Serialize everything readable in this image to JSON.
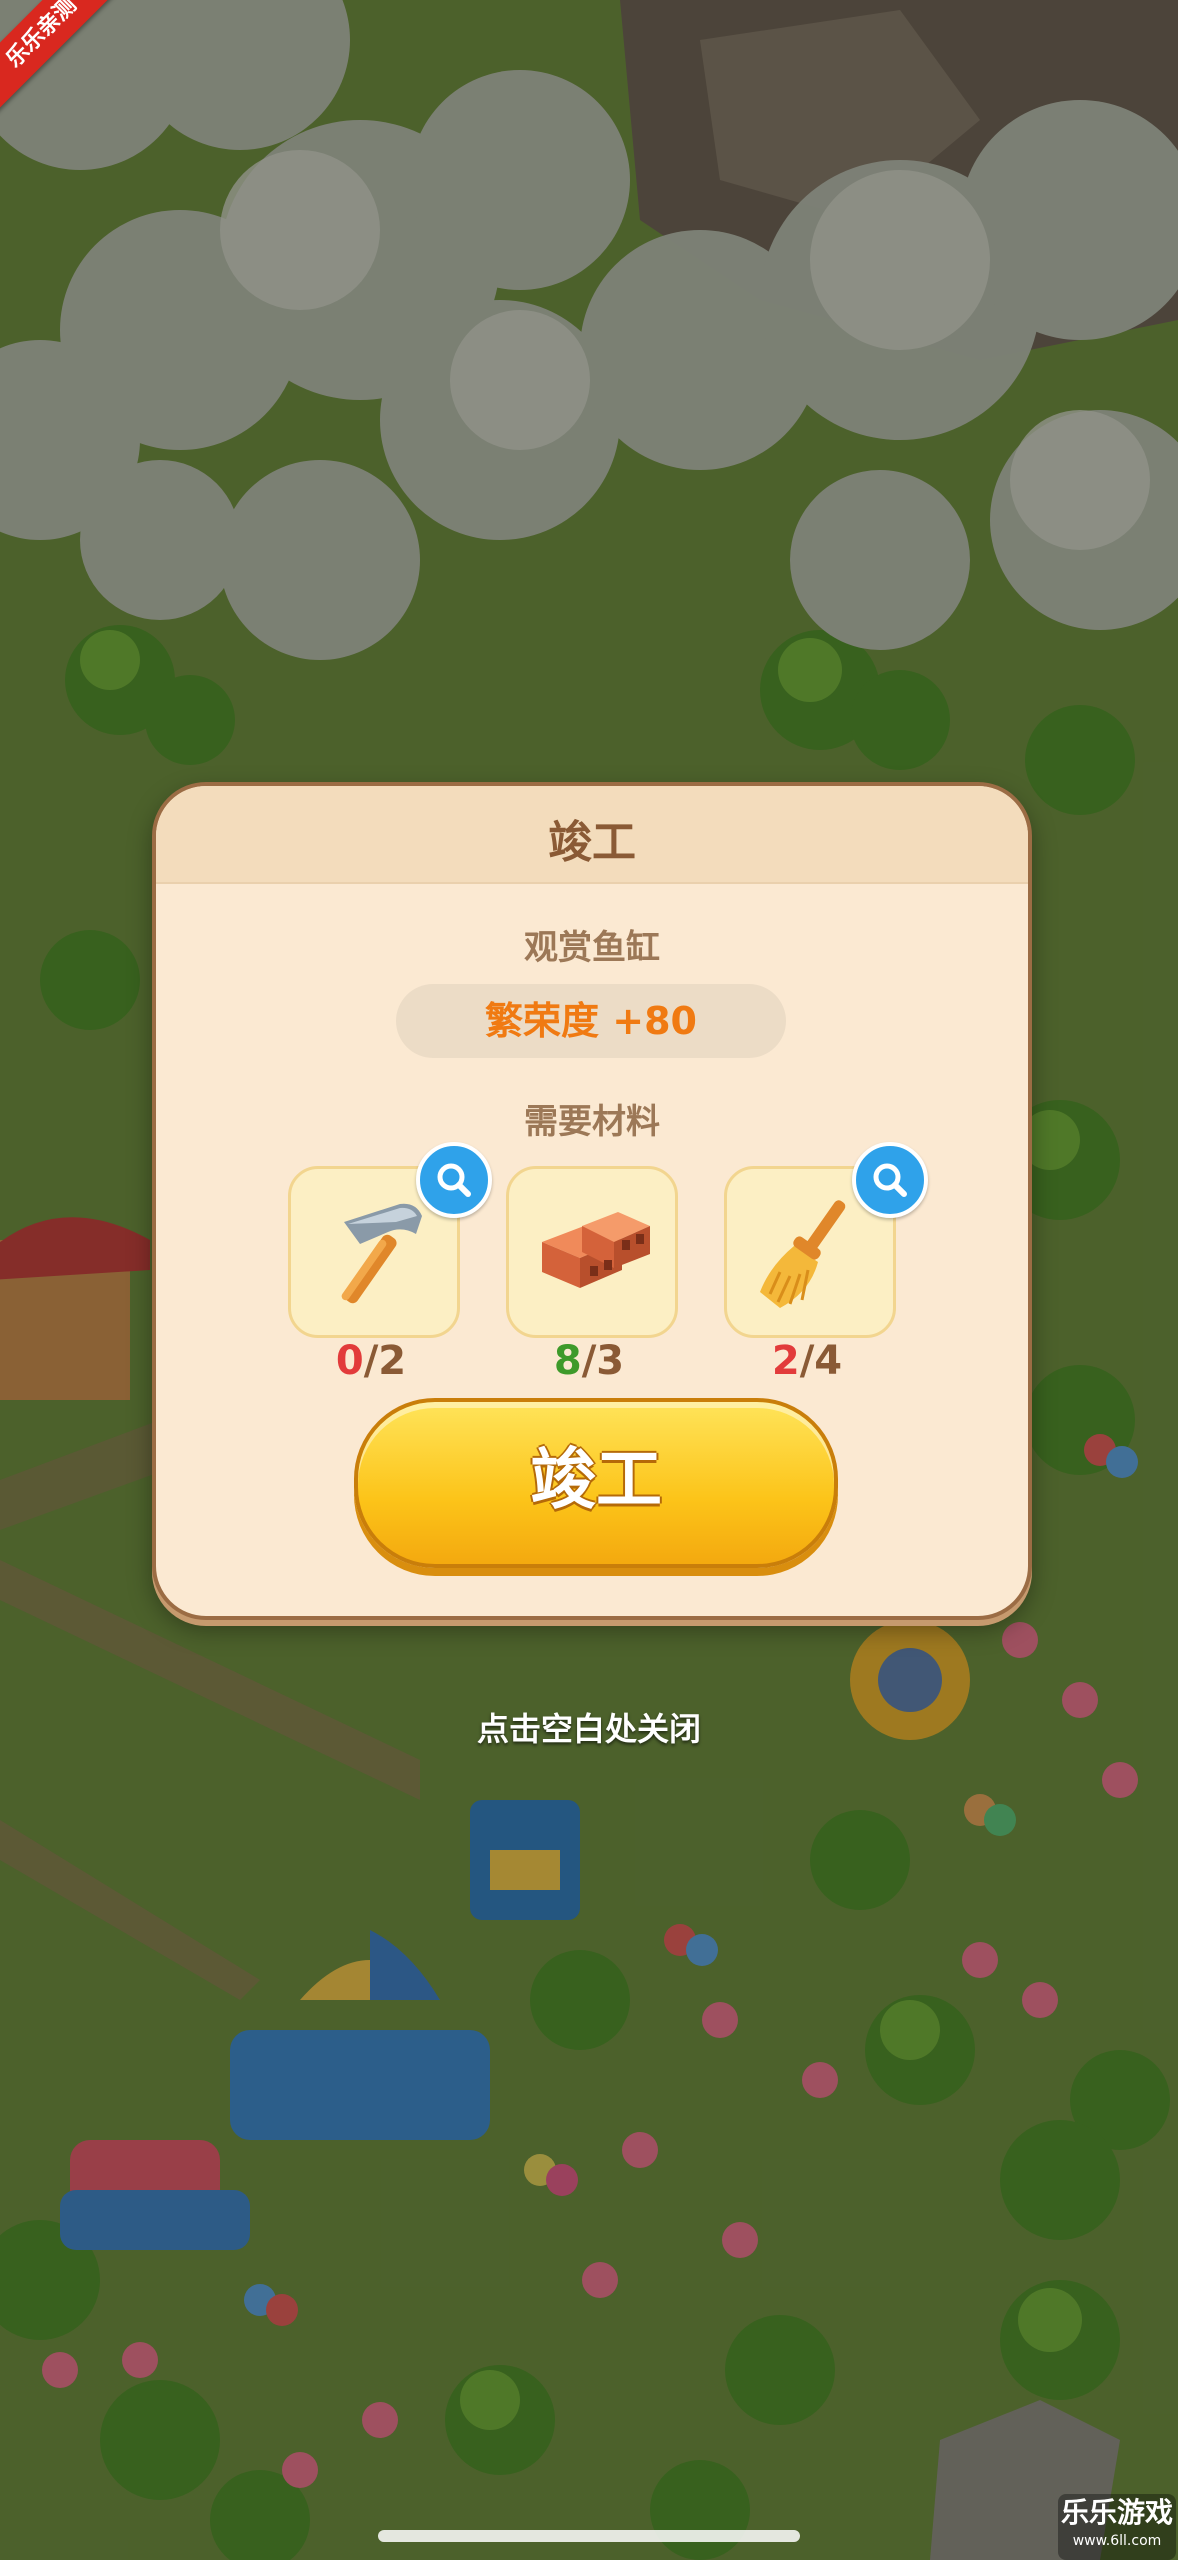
{
  "corner_tag": "乐乐亲测",
  "dialog": {
    "title": "竣工",
    "building_name": "观赏鱼缸",
    "prosperity": "繁荣度 +80",
    "materials_label": "需要材料",
    "materials": [
      {
        "icon": "hammer-icon",
        "have": "0",
        "need": "/2",
        "has_search": true
      },
      {
        "icon": "bricks-icon",
        "have": "8",
        "need": "/3",
        "has_search": false
      },
      {
        "icon": "broom-icon",
        "have": "2",
        "need": "/4",
        "has_search": true
      }
    ],
    "confirm_label": "竣工"
  },
  "close_hint": "点击空白处关闭",
  "watermark": {
    "main": "乐乐游戏",
    "sub": "www.6ll.com"
  },
  "colors": {
    "accent": "#fcc419",
    "prosperity": "#f07a12",
    "insufficient": "#e23b3b",
    "sufficient": "#3e9a2a",
    "search_badge": "#2fa2ea"
  }
}
